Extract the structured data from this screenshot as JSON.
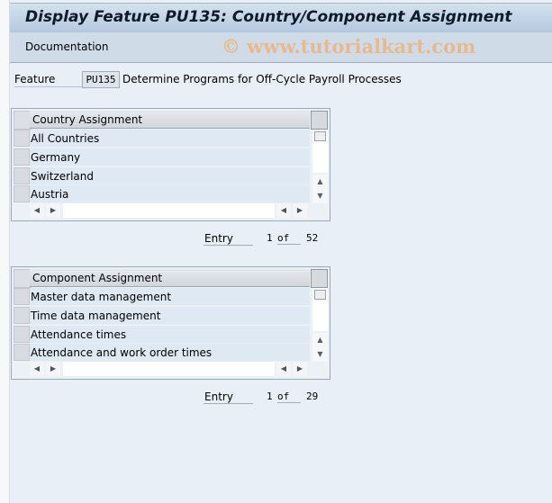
{
  "title": "Display Feature PU135: Country/Component Assignment",
  "toolbar": {
    "documentation_label": "Documentation",
    "watermark": "© www.tutorialkart.com"
  },
  "feature": {
    "label": "Feature",
    "value": "PU135",
    "description": "Determine Programs for Off-Cycle Payroll Processes"
  },
  "country_table": {
    "header": "Country Assignment",
    "rows": [
      "All Countries",
      "Germany",
      "Switzerland",
      "Austria"
    ],
    "entry": {
      "label": "Entry",
      "current": "1",
      "of_label": "of",
      "total": "52"
    }
  },
  "component_table": {
    "header": "Component Assignment",
    "rows": [
      "Master data management",
      "Time data management",
      "Attendance times",
      "Attendance and work order times"
    ],
    "entry": {
      "label": "Entry",
      "current": "1",
      "of_label": "of",
      "total": "29"
    }
  },
  "icons": {
    "scroll_up": "▲",
    "scroll_down": "▼",
    "scroll_left": "◀",
    "scroll_right": "▶"
  }
}
